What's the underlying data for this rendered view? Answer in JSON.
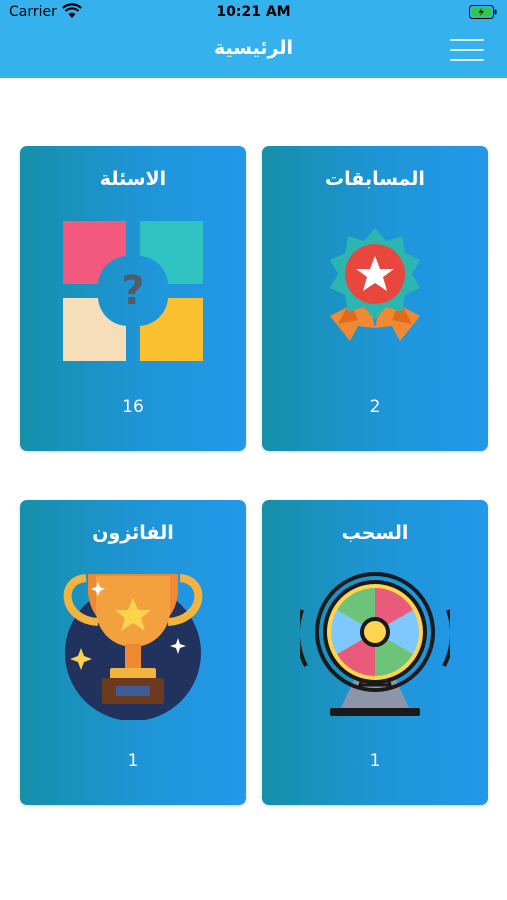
{
  "status_bar": {
    "carrier": "Carrier",
    "time": "10:21 AM"
  },
  "nav": {
    "title": "الرئيسية",
    "menu_icon": "hamburger-icon"
  },
  "cards": [
    {
      "title": "المسابقات",
      "count": "2",
      "icon": "medal-icon"
    },
    {
      "title": "الاسئلة",
      "count": "16",
      "icon": "question-puzzle-icon"
    },
    {
      "title": "السحب",
      "count": "1",
      "icon": "lottery-wheel-icon"
    },
    {
      "title": "الفائزون",
      "count": "1",
      "icon": "trophy-icon"
    }
  ],
  "colors": {
    "header": "#35b2ee",
    "card_start": "#168fa9",
    "card_end": "#2398ea"
  }
}
